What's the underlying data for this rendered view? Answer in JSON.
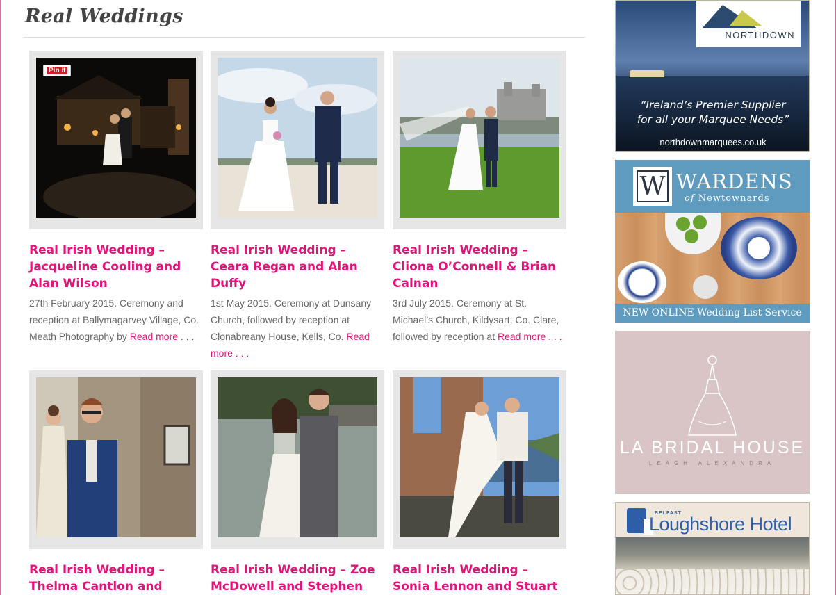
{
  "page": {
    "section_title": "Real Weddings"
  },
  "weddings": [
    {
      "title": "Real Irish Wedding – Jacqueline Cooling and Alan Wilson",
      "excerpt": "27th February 2015. Ceremony and reception at Ballymagarvey Village, Co. Meath Photography by ",
      "read_more": "Read more . . .",
      "pin_label": "Pin it",
      "photo": "night-venue-couple"
    },
    {
      "title": "Real Irish Wedding – Ceara Regan and Alan Duffy",
      "excerpt": "1st May 2015. Ceremony at Dunsany Church, followed by reception at Clonabreany House, Kells, Co. ",
      "read_more": "Read more . . .",
      "photo": "seaside-couple"
    },
    {
      "title": "Real Irish Wedding – Cliona O’Connell & Brian Calnan",
      "excerpt": "3rd July 2015. Ceremony at St. Michael’s Church, Kildysart, Co. Clare, followed by reception at ",
      "read_more": "Read more . . .",
      "photo": "castle-lawn-couple"
    },
    {
      "title": "Real Irish Wedding – Thelma Cantlon and David Murtagh",
      "photo": "stone-wall-couple"
    },
    {
      "title": "Real Irish Wedding – Zoe McDowell and Stephen",
      "photo": "lakeside-couple"
    },
    {
      "title": "Real Irish Wedding – Sonia Lennon and Stuart Mullen",
      "photo": "ruin-lift-couple"
    }
  ],
  "sidebar": {
    "northdown": {
      "logo_text": "NORTHDOWN",
      "tagline_line1": "“Ireland’s Premier Supplier",
      "tagline_line2": "for all your Marquee Needs”",
      "url": "northdownmarquees.co.uk"
    },
    "wardens": {
      "logo_letter": "W",
      "brand": "WARDENS",
      "sub_of": "of",
      "sub_place": "Newtownards",
      "banner": "NEW ONLINE Wedding List Service"
    },
    "bridal": {
      "name": "LA BRIDAL HOUSE",
      "sub": "LEAGH ALEXANDRA"
    },
    "loughshore": {
      "belfast": "BELFAST",
      "name": "Loughshore Hotel"
    }
  },
  "colors": {
    "accent_pink": "#e0157a",
    "frame_pink": "#c9749f",
    "card_frame": "#e6e6e6"
  }
}
